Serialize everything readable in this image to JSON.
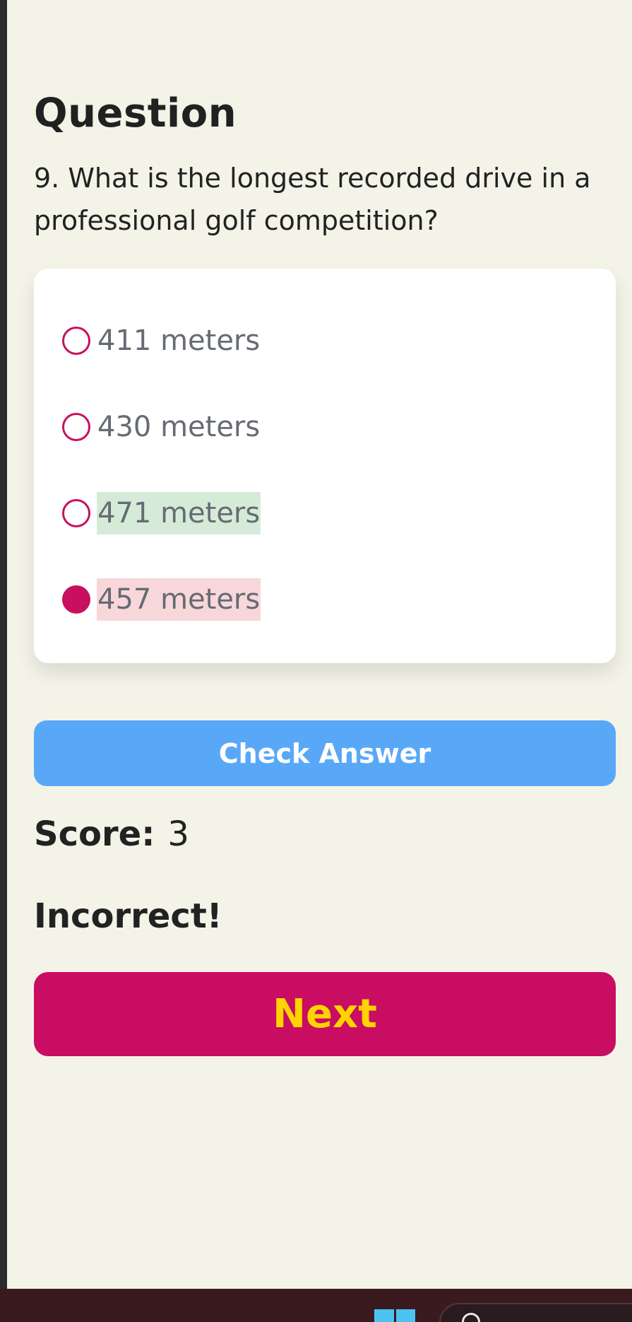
{
  "quiz": {
    "heading": "Question",
    "question": "9. What is the longest recorded drive in a professional golf competition?",
    "options": [
      {
        "label": "411 meters",
        "selected": false,
        "state": "none"
      },
      {
        "label": "430 meters",
        "selected": false,
        "state": "none"
      },
      {
        "label": "471 meters",
        "selected": false,
        "state": "correct"
      },
      {
        "label": "457 meters",
        "selected": true,
        "state": "wrong"
      }
    ],
    "check_button_label": "Check Answer",
    "score_label": "Score:",
    "score_value": "3",
    "feedback": "Incorrect!",
    "next_button_label": "Next"
  },
  "taskbar": {
    "icons": [
      "windows-start-icon",
      "search-icon"
    ]
  },
  "colors": {
    "background": "#f4f3e8",
    "accent": "#c8105f",
    "check_button": "#59a8f8",
    "next_button": "#c80d62",
    "next_text": "#ffd400",
    "correct_highlight": "#d5ebd8",
    "wrong_highlight": "#f8d7da"
  }
}
